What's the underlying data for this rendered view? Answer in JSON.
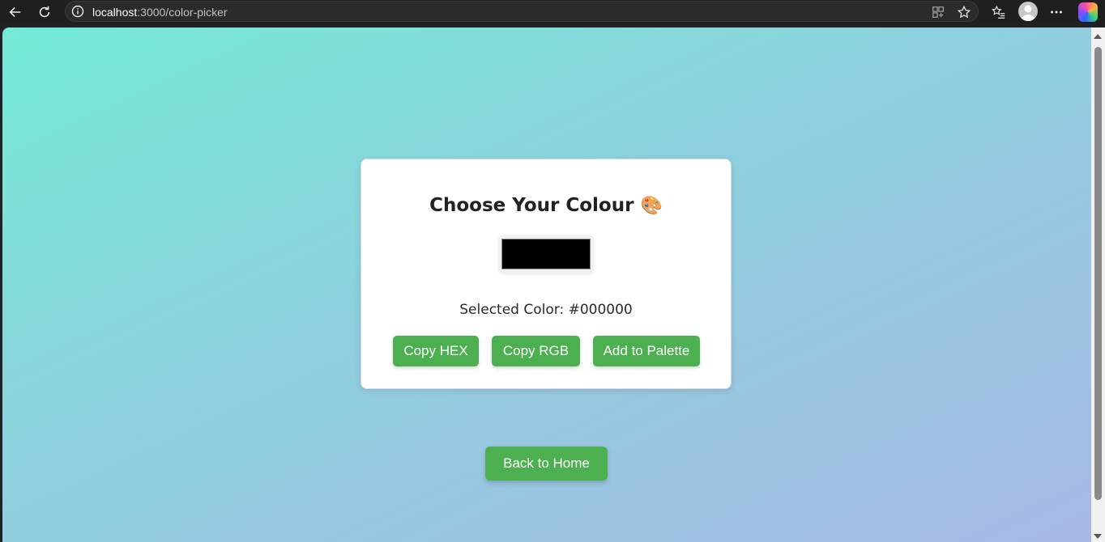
{
  "browser": {
    "url_host": "localhost",
    "url_path": ":3000/color-picker"
  },
  "page": {
    "title": "Choose Your Colour",
    "title_emoji": "🎨",
    "selected_label": "Selected Color:",
    "selected_value": "#000000",
    "swatch_color": "#000000",
    "buttons": {
      "copy_hex": "Copy HEX",
      "copy_rgb": "Copy RGB",
      "add_palette": "Add to Palette"
    },
    "back_home": "Back to Home"
  },
  "colors": {
    "button_green": "#4caf50",
    "gradient_start": "#74ead6",
    "gradient_end": "#a7b8e4"
  },
  "icons": [
    "back-arrow-icon",
    "reload-icon",
    "info-icon",
    "apps-icon",
    "star-icon",
    "favorites-icon",
    "profile-icon",
    "more-icon",
    "copilot-icon"
  ]
}
